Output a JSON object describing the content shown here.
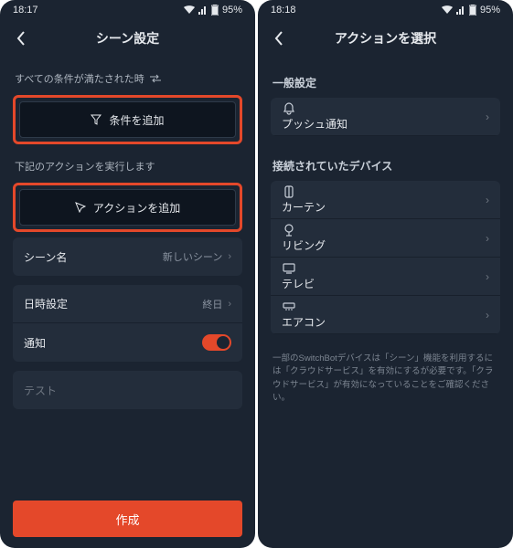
{
  "left": {
    "status": {
      "time": "18:17",
      "battery": "95%"
    },
    "header": {
      "title": "シーン設定"
    },
    "section_conditions_label": "すべての条件が満たされた時",
    "add_condition_label": "条件を追加",
    "section_actions_label": "下記のアクションを実行します",
    "add_action_label": "アクションを追加",
    "rows": {
      "scene_name_label": "シーン名",
      "scene_name_value": "新しいシーン",
      "datetime_label": "日時設定",
      "datetime_value": "終日",
      "notify_label": "通知"
    },
    "test_placeholder": "テスト",
    "create_label": "作成"
  },
  "right": {
    "status": {
      "time": "18:18",
      "battery": "95%"
    },
    "header": {
      "title": "アクションを選択"
    },
    "section_general": "一般設定",
    "push_label": "プッシュ通知",
    "section_devices": "接続されていたデバイス",
    "devices": {
      "curtain": "カーテン",
      "living": "リビング",
      "tv": "テレビ",
      "ac": "エアコン"
    },
    "hint": "一部のSwitchBotデバイスは「シーン」機能を利用するには「クラウドサービス」を有効にするが必要です。「クラウドサービス」が有効になっていることをご確認ください。"
  }
}
